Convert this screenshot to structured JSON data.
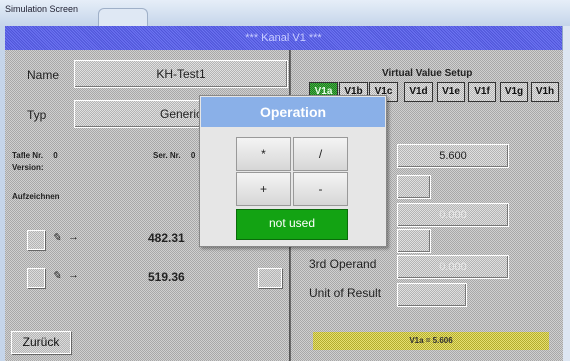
{
  "window": {
    "title": "Simulation Screen"
  },
  "header": {
    "title": "*** Kanal V1 ***"
  },
  "left": {
    "name_label": "Name",
    "name_value": "KH-Test1",
    "typ_label": "Typ",
    "typ_value": "Generic",
    "tafle_label": "Tafle Nr.",
    "tafle_value": "0",
    "ser_label": "Ser. Nr.",
    "ser_value": "0",
    "version_label": "Version:",
    "aufzeichnen_label": "Aufzeichnen",
    "row1_value": "482.31",
    "row2_value": "519.36",
    "back_button": "Zurück"
  },
  "right": {
    "setup_title": "Virtual Value Setup",
    "tabs": [
      "V1a",
      "V1b",
      "V1c",
      "V1d",
      "V1e",
      "V1f",
      "V1g",
      "V1h"
    ],
    "active_tab": "V1a",
    "value1": "5.600",
    "value2": "0.000",
    "value3": "0.000",
    "operand3_label": "3rd Operand",
    "unit_label": "Unit of Result",
    "status": "V1a = 5.606"
  },
  "dialog": {
    "title": "Operation",
    "ops": [
      "*",
      "/",
      "+",
      "-"
    ],
    "not_used": "not used"
  },
  "colors": {
    "header": "#5a60e8",
    "tab_active": "#2a8f2a",
    "dialog_title": "#8ab0e8",
    "not_used_button": "#13a313"
  },
  "icons": [
    "pen-icon",
    "arrow-right-icon"
  ]
}
